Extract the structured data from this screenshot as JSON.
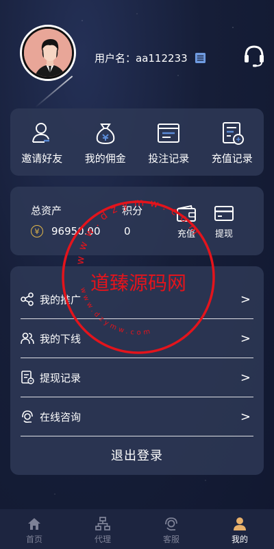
{
  "header": {
    "username_label": "用户名：aa112233"
  },
  "quick_actions": [
    {
      "label": "邀请好友",
      "icon": "person-add-icon"
    },
    {
      "label": "我的佣金",
      "icon": "money-bag-icon"
    },
    {
      "label": "投注记录",
      "icon": "list-window-icon"
    },
    {
      "label": "充值记录",
      "icon": "recharge-record-icon"
    }
  ],
  "assets": {
    "total_label": "总资产",
    "total_value": "96950.00",
    "points_label": "积分",
    "points_value": "0",
    "recharge_label": "充值",
    "withdraw_label": "提现",
    "currency_symbol": "¥"
  },
  "menu": [
    {
      "label": "我的推广",
      "icon": "share-icon"
    },
    {
      "label": "我的下线",
      "icon": "users-icon"
    },
    {
      "label": "提现记录",
      "icon": "withdraw-record-icon"
    },
    {
      "label": "在线咨询",
      "icon": "support-icon"
    }
  ],
  "menu_chevron": ">",
  "logout_label": "退出登录",
  "tabs": [
    {
      "label": "首页",
      "icon": "home-icon",
      "active": false
    },
    {
      "label": "代理",
      "icon": "agent-icon",
      "active": false
    },
    {
      "label": "客服",
      "icon": "service-icon",
      "active": false
    },
    {
      "label": "我的",
      "icon": "profile-icon",
      "active": true
    }
  ],
  "watermark": {
    "center_text": "道臻源码网",
    "ring_text_top": "www.dzymw.com",
    "ring_text_bottom": "www.dzymw.com",
    "color": "#e3141c"
  },
  "colors": {
    "panel": "#2e3856",
    "accent_blue": "#5b8cd8",
    "coin_gold": "#e3b84a",
    "active_tab_icon": "#e8b06a"
  }
}
